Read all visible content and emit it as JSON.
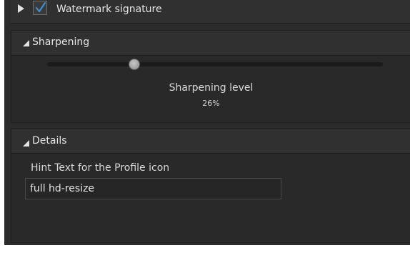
{
  "watermark": {
    "label": "Watermark signature",
    "checked": true
  },
  "sharpening": {
    "title": "Sharpening",
    "slider_label": "Sharpening level",
    "value_text": "26%",
    "value": 0.26
  },
  "details": {
    "title": "Details",
    "field_label": "Hint Text for the Profile icon",
    "field_value": "full hd-resize"
  },
  "colors": {
    "panel": "#2b2b2b",
    "header": "#303030",
    "text": "#e6e6e6",
    "check": "#3a8fd6"
  },
  "icons": {
    "expand": "triangle-right-icon",
    "collapse": "triangle-down-icon",
    "check": "checkmark-icon"
  }
}
